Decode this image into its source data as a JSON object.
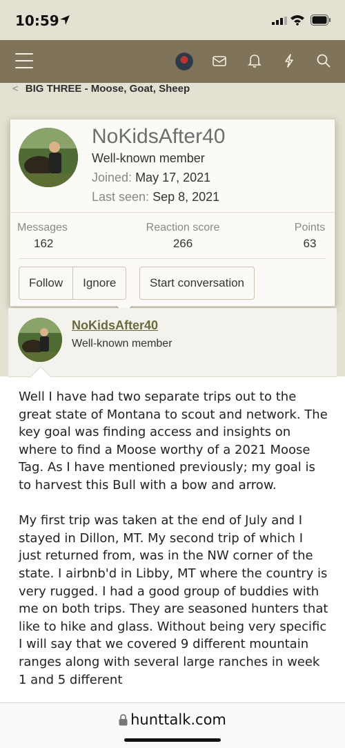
{
  "status_bar": {
    "time": "10:59"
  },
  "breadcrumb": {
    "label": "BIG THREE - Moose, Goat, Sheep"
  },
  "profile_card": {
    "username": "NoKidsAfter40",
    "role": "Well-known member",
    "joined_label": "Joined:",
    "joined_value": "May 17, 2021",
    "last_seen_label": "Last seen:",
    "last_seen_value": "Sep 8, 2021",
    "stats": {
      "messages_label": "Messages",
      "messages_value": "162",
      "reaction_label": "Reaction score",
      "reaction_value": "266",
      "points_label": "Points",
      "points_value": "63"
    },
    "buttons": {
      "follow": "Follow",
      "ignore": "Ignore",
      "start_conversation": "Start conversation"
    }
  },
  "post": {
    "username": "NoKidsAfter40",
    "role": "Well-known member",
    "paragraph1": "Well I have had two separate trips out to the great state of Montana to scout and network. The key goal was finding access and insights on where to find a Moose worthy of a 2021 Moose Tag. As I have mentioned previously; my goal is to harvest this Bull with a bow and arrow.",
    "paragraph2": "My first trip was taken at the end of July and I stayed in Dillon, MT. My second trip of which I just returned from, was in the NW corner of the state. I airbnb'd in Libby, MT where the country is very rugged. I had a good group of buddies with me on both trips. They are seasoned hunters that like to hike and glass. Without being very specific I will say that we covered 9 different mountain ranges along with several large ranches in week 1 and 5 different"
  },
  "url_bar": {
    "domain": "hunttalk.com"
  },
  "colors": {
    "nav": "#7f735a",
    "page_bg": "#e5e1d2",
    "username_link": "#6b6a3d"
  }
}
